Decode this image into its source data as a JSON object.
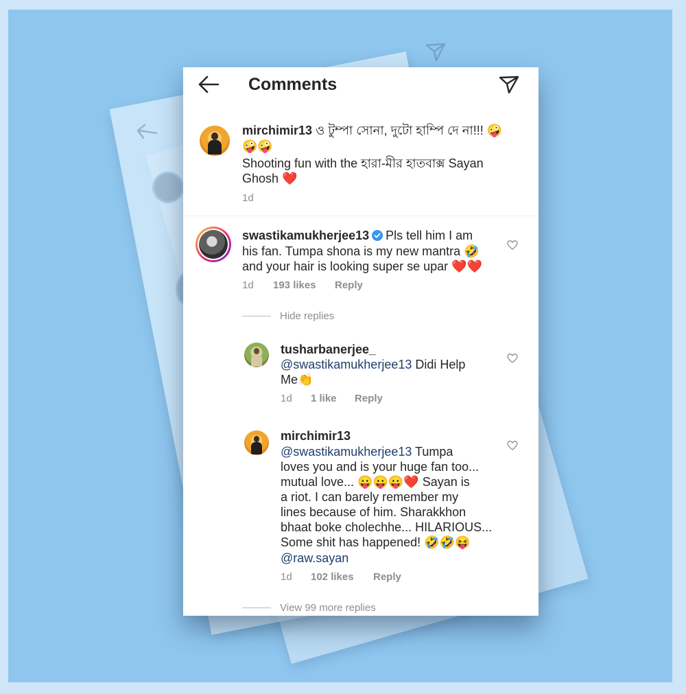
{
  "header": {
    "title": "Comments"
  },
  "caption": {
    "username": "mirchimir13",
    "text_line1": " ও টুম্পা সোনা, দুটো হাম্পি দে না!!! 🤪",
    "text_line2": "🤪🤪",
    "text_line3": "Shooting fun with the হারা-মীর হাতবাক্স Sayan",
    "text_line4": "Ghosh ❤️",
    "time": "1d"
  },
  "comments": [
    {
      "username": "swastikamukherjee13",
      "line1": "Pls tell him I am",
      "line2": "his fan. Tumpa shona is my new mantra 🤣",
      "line3": "and your hair is looking super se upar ❤️❤️",
      "time": "1d",
      "likes": "193 likes",
      "reply": "Reply",
      "hide_replies": "Hide replies",
      "replies": [
        {
          "username": "tusharbanerjee_",
          "mention": "@swastikamukherjee13",
          "line1": " Didi Help",
          "line2": "Me👏",
          "time": "1d",
          "likes": "1 like",
          "reply": "Reply"
        },
        {
          "username": "mirchimir13",
          "mention": "@swastikamukherjee13",
          "line1": " Tumpa",
          "line2": "loves you and is your huge fan too...",
          "line3": "mutual love... 😛😛😛❤️ Sayan is",
          "line4": "a riot. I can barely remember my",
          "line5": "lines because of him. Sharakkhon",
          "line6": "bhaat boke cholechhe... HILARIOUS...",
          "line7": "Some shit has happened! 🤣🤣😝",
          "mention2": "@raw.sayan",
          "time": "1d",
          "likes": "102 likes",
          "reply": "Reply"
        }
      ],
      "view_more": "View 99 more replies"
    }
  ],
  "icons": {
    "back": "arrow-left-icon",
    "send": "paper-plane-icon",
    "heart": "heart-outline-icon",
    "verified": "verified-badge-icon"
  },
  "colors": {
    "background": "#8fc6ee",
    "text": "#262626",
    "muted": "#8e8e8e",
    "mention": "#1f3f6b",
    "verified": "#3897f0"
  }
}
